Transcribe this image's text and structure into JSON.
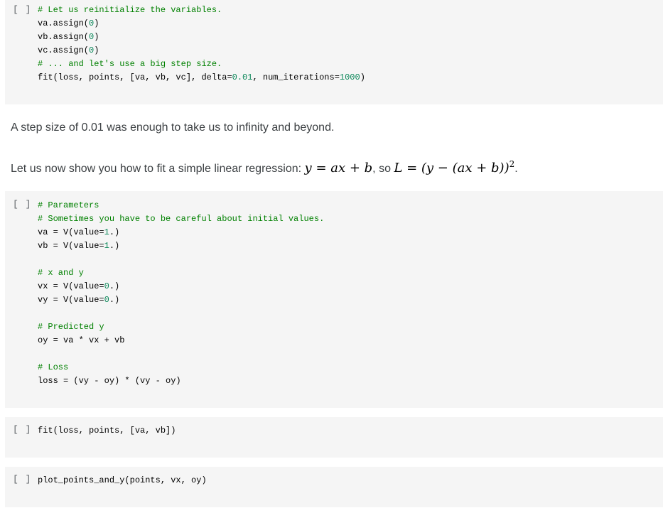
{
  "colors": {
    "cell_bg": "#f5f5f5",
    "comment": "#008000",
    "number": "#098658",
    "text": "#3c4043"
  },
  "run_button_label": "[ ]",
  "cells": [
    {
      "type": "code",
      "lines": [
        {
          "segments": [
            {
              "t": "# Let us reinitialize the variables.",
              "c": "cm"
            }
          ]
        },
        {
          "segments": [
            {
              "t": "va.assign(",
              "c": ""
            },
            {
              "t": "0",
              "c": "num"
            },
            {
              "t": ")",
              "c": ""
            }
          ]
        },
        {
          "segments": [
            {
              "t": "vb.assign(",
              "c": ""
            },
            {
              "t": "0",
              "c": "num"
            },
            {
              "t": ")",
              "c": ""
            }
          ]
        },
        {
          "segments": [
            {
              "t": "vc.assign(",
              "c": ""
            },
            {
              "t": "0",
              "c": "num"
            },
            {
              "t": ")",
              "c": ""
            }
          ]
        },
        {
          "segments": [
            {
              "t": "# ... and let's use a big step size.",
              "c": "cm"
            }
          ]
        },
        {
          "segments": [
            {
              "t": "fit(loss, points, [va, vb, vc], delta=",
              "c": ""
            },
            {
              "t": "0.01",
              "c": "num"
            },
            {
              "t": ", num_iterations=",
              "c": ""
            },
            {
              "t": "1000",
              "c": "num"
            },
            {
              "t": ")",
              "c": ""
            }
          ]
        }
      ]
    },
    {
      "type": "markdown",
      "text": "A step size of 0.01 was enough to take us to infinity and beyond."
    },
    {
      "type": "markdown",
      "text_prefix": "Let us now show you how to fit a simple linear regression: ",
      "math1": "y = ax + b",
      "text_mid": ", so ",
      "math2": "L = (y − (ax + b))",
      "math2_sup": "2",
      "text_suffix": "."
    },
    {
      "type": "code",
      "lines": [
        {
          "segments": [
            {
              "t": "# Parameters",
              "c": "cm"
            }
          ]
        },
        {
          "segments": [
            {
              "t": "# Sometimes you have to be careful about initial values.",
              "c": "cm"
            }
          ]
        },
        {
          "segments": [
            {
              "t": "va = V(value=",
              "c": ""
            },
            {
              "t": "1",
              "c": "num"
            },
            {
              "t": ".)",
              "c": ""
            }
          ]
        },
        {
          "segments": [
            {
              "t": "vb = V(value=",
              "c": ""
            },
            {
              "t": "1",
              "c": "num"
            },
            {
              "t": ".)",
              "c": ""
            }
          ]
        },
        {
          "segments": [
            {
              "t": "",
              "c": ""
            }
          ]
        },
        {
          "segments": [
            {
              "t": "# x and y",
              "c": "cm"
            }
          ]
        },
        {
          "segments": [
            {
              "t": "vx = V(value=",
              "c": ""
            },
            {
              "t": "0",
              "c": "num"
            },
            {
              "t": ".)",
              "c": ""
            }
          ]
        },
        {
          "segments": [
            {
              "t": "vy = V(value=",
              "c": ""
            },
            {
              "t": "0",
              "c": "num"
            },
            {
              "t": ".)",
              "c": ""
            }
          ]
        },
        {
          "segments": [
            {
              "t": "",
              "c": ""
            }
          ]
        },
        {
          "segments": [
            {
              "t": "# Predicted y",
              "c": "cm"
            }
          ]
        },
        {
          "segments": [
            {
              "t": "oy = va * vx + vb",
              "c": ""
            }
          ]
        },
        {
          "segments": [
            {
              "t": "",
              "c": ""
            }
          ]
        },
        {
          "segments": [
            {
              "t": "# Loss",
              "c": "cm"
            }
          ]
        },
        {
          "segments": [
            {
              "t": "loss = (vy - oy) * (vy - oy)",
              "c": ""
            }
          ]
        }
      ]
    },
    {
      "type": "code",
      "lines": [
        {
          "segments": [
            {
              "t": "fit(loss, points, [va, vb])",
              "c": ""
            }
          ]
        }
      ]
    },
    {
      "type": "code",
      "lines": [
        {
          "segments": [
            {
              "t": "plot_points_and_y(points, vx, oy)",
              "c": ""
            }
          ]
        }
      ]
    }
  ]
}
